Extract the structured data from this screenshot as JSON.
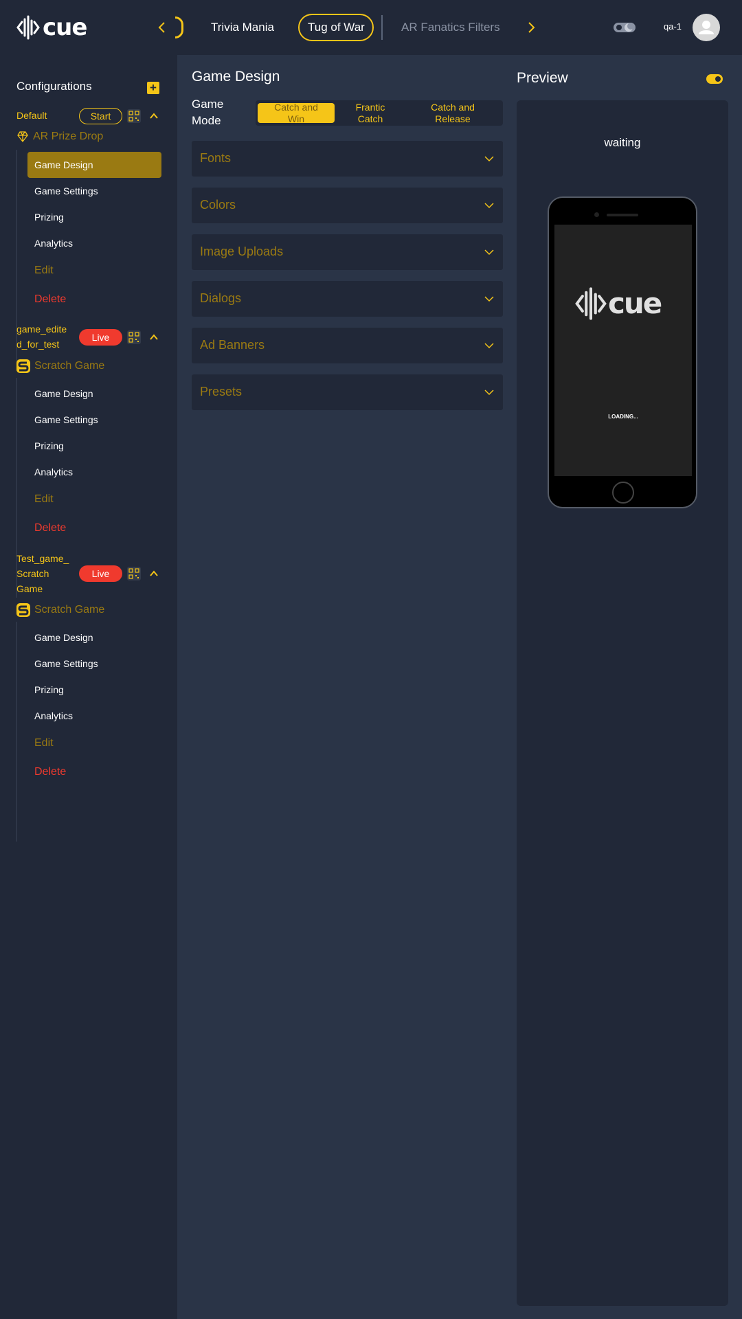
{
  "brand": {
    "logo_text": "cue"
  },
  "tabs": {
    "items": [
      {
        "label": "Trivia Mania"
      },
      {
        "label": "Tug of War"
      },
      {
        "label": "AR Fanatics Filters"
      }
    ],
    "active_index": 1
  },
  "user": {
    "name": "qa-1"
  },
  "sidebar": {
    "title": "Configurations",
    "configs": [
      {
        "name_lines": [
          "Default"
        ],
        "status": "Start",
        "game_type": "AR Prize Drop",
        "menu": [
          "Game Design",
          "Game Settings",
          "Prizing",
          "Analytics",
          "Edit",
          "Delete"
        ],
        "active_item": "Game Design"
      },
      {
        "name_lines": [
          "game_edite",
          "d_for_test"
        ],
        "status": "Live",
        "game_type": "Scratch Game",
        "menu": [
          "Game Design",
          "Game Settings",
          "Prizing",
          "Analytics",
          "Edit",
          "Delete"
        ]
      },
      {
        "name_lines": [
          "Test_game_",
          "Scratch",
          "Game"
        ],
        "status": "Live",
        "game_type": "Scratch Game",
        "menu": [
          "Game Design",
          "Game Settings",
          "Prizing",
          "Analytics",
          "Edit",
          "Delete"
        ]
      }
    ]
  },
  "main": {
    "title": "Game Design",
    "game_mode": {
      "label_lines": [
        "Game",
        "Mode"
      ],
      "options": [
        {
          "lines": [
            "Catch and",
            "Win"
          ]
        },
        {
          "lines": [
            "Frantic",
            "Catch"
          ]
        },
        {
          "lines": [
            "Catch and",
            "Release"
          ]
        }
      ],
      "selected_index": 0
    },
    "sections": [
      "Fonts",
      "Colors",
      "Image Uploads",
      "Dialogs",
      "Ad Banners",
      "Presets"
    ]
  },
  "preview": {
    "title": "Preview",
    "status": "waiting",
    "screen_logo_text": "cue",
    "loading_text": "LOADING..."
  },
  "colors": {
    "accent": "#f5c518",
    "accent_dim": "#9a7a12",
    "live_red": "#f03a2e",
    "background": "#212838",
    "panel": "#2a3447"
  },
  "icons": {
    "nav_prev": "chevron-left-icon",
    "nav_next": "chevron-right-icon",
    "theme": "theme-toggle-icon",
    "avatar": "user-icon",
    "add": "plus-icon",
    "qr": "qr-code-icon",
    "collapse": "chevron-up-icon",
    "expand": "chevron-down-icon",
    "ar_game": "diamond-icon",
    "scratch_game": "scratch-s-icon"
  }
}
